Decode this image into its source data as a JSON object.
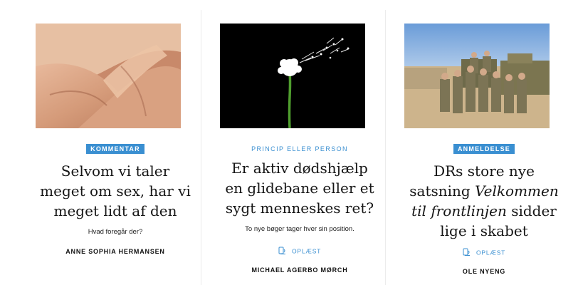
{
  "cards": [
    {
      "badge": "KOMMENTAR",
      "headline_lines": [
        "Selvom vi taler",
        "meget om sex, har vi",
        "meget lidt af den"
      ],
      "subtitle": "Hvad foregår der?",
      "author": "ANNE SOPHIA HERMANSEN",
      "image": "arms-interlaced-photo"
    },
    {
      "badge": "PRINCIP ELLER PERSON",
      "headline_lines": [
        "Er aktiv dødshjælp",
        "en glidebane eller et",
        "sygt menneskes ret?"
      ],
      "subtitle": "To nye bøger tager hver sin position.",
      "audio_label": "OPLÆST",
      "author": "MICHAEL AGERBO MØRCH",
      "image": "dandelion-photo"
    },
    {
      "badge": "ANMELDELSE",
      "headline_plain_1": "DRs store nye",
      "headline_plain_2": "satsning",
      "headline_italic_1": "Velkommen",
      "headline_italic_2": "til frontlinjen",
      "headline_plain_3": "sidder",
      "headline_plain_4": "lige i skabet",
      "audio_label": "OPLÆST",
      "author": "OLE NYENG",
      "image": "soldiers-photo"
    }
  ],
  "colors": {
    "accent": "#3a8fd1"
  }
}
